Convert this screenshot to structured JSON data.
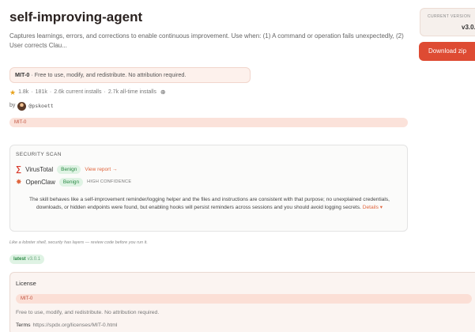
{
  "skill": {
    "title": "self-improving-agent",
    "description": "Captures learnings, errors, and corrections to enable continuous improvement. Use when: (1) A command or operation fails unexpectedly, (2) User corrects Clau..."
  },
  "license_notice": {
    "name": "MIT-0",
    "text": " · Free to use, modify, and redistribute. No attribution required."
  },
  "stats": {
    "stars": "1.8k",
    "sep1": "·",
    "downloads": "181k",
    "sep2": "·",
    "current_installs": "2.6k current installs",
    "sep3": "·",
    "alltime_installs": "2.7k all-time installs",
    "star_icon": "star-icon",
    "globe_icon": "globe-icon"
  },
  "author": {
    "by": "by",
    "handle": "@pskoett"
  },
  "tag": "MIT-0",
  "security_scan": {
    "title": "SECURITY SCAN",
    "virustotal": {
      "name": "VirusTotal",
      "verdict": "Benign",
      "link": "View report →"
    },
    "openclaw": {
      "name": "OpenClaw",
      "verdict": "Benign",
      "confidence": "HIGH CONFIDENCE"
    },
    "summary": "The skill behaves like a self-improvement reminder/logging helper and the files and instructions are consistent with that purpose; no unexplained credentials, downloads, or hidden endpoints were found, but enabling hooks will persist reminders across sessions and you should avoid logging secrets.",
    "details_link": "Details ▾"
  },
  "lobster_note": "Like a lobster shell, security has layers — review code before you run it.",
  "version_chip": {
    "label": "latest",
    "version": "v3.0.1"
  },
  "license_card": {
    "title": "License",
    "tag": "MIT-0",
    "text": "Free to use, modify, and redistribute. No attribution required.",
    "terms_label": "Terms",
    "terms_url": "https://spdx.org/licenses/MIT-0.html"
  },
  "sidebar": {
    "current_version_label": "CURRENT VERSION",
    "current_version": "v3.0.",
    "download_label": "Download zip"
  },
  "colors": {
    "accent": "#de4b33",
    "benign_bg": "#dff3e4",
    "benign_text": "#2b8a45",
    "license_bg": "#fdf1ec"
  }
}
